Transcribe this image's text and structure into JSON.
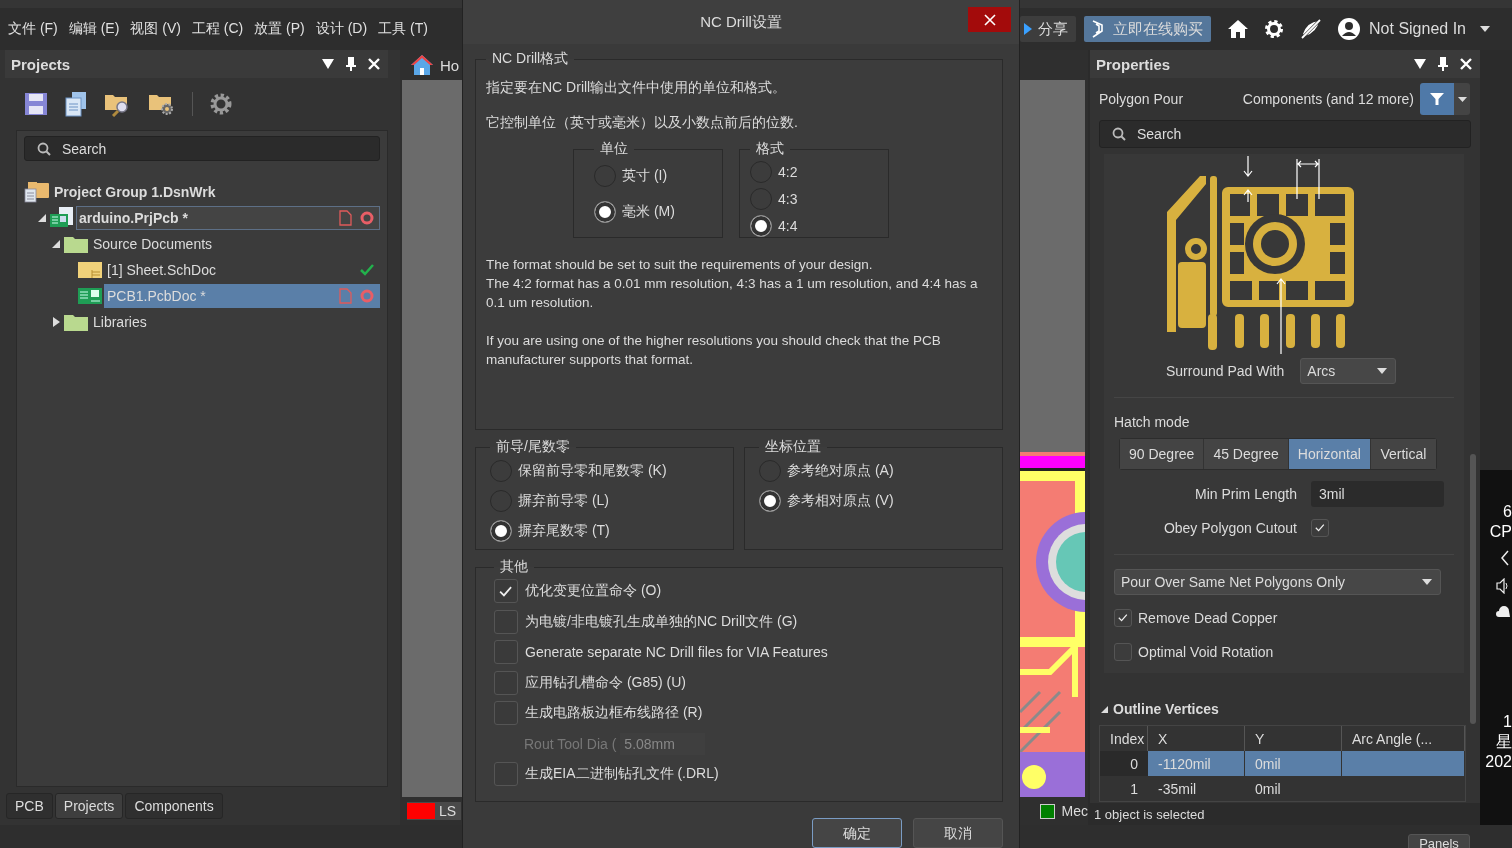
{
  "menubar": {
    "items": [
      "文件 (F)",
      "编辑 (E)",
      "视图 (V)",
      "工程 (C)",
      "放置 (P)",
      "设计 (D)",
      "工具 (T)"
    ],
    "share_button": "分享",
    "buy_button": "立即在线购买",
    "user": "Not Signed In"
  },
  "projects_panel": {
    "title": "Projects",
    "search": {
      "placeholder": "Search"
    },
    "tree": [
      {
        "label": "Project Group 1.DsnWrk",
        "kind": "group",
        "selected": false,
        "focused": false,
        "children": [
          {
            "label": "arduino.PrjPcb *",
            "kind": "project",
            "expanded": true,
            "selected": false,
            "focused": true,
            "modified": true,
            "children": [
              {
                "label": "Source Documents",
                "kind": "folder",
                "expanded": true,
                "selected": false,
                "focused": false,
                "children": [
                  {
                    "label": "[1] Sheet.SchDoc",
                    "kind": "sch",
                    "selected": false,
                    "focused": false,
                    "modified": false
                  },
                  {
                    "label": "PCB1.PcbDoc *",
                    "kind": "pcb",
                    "selected": true,
                    "focused": false,
                    "modified": true
                  }
                ]
              },
              {
                "label": "Libraries",
                "kind": "folder",
                "expanded": false,
                "selected": false,
                "focused": false
              }
            ]
          }
        ]
      }
    ],
    "tabs": [
      {
        "label": "PCB",
        "selected": false
      },
      {
        "label": "Projects",
        "selected": true
      },
      {
        "label": "Components",
        "selected": false
      }
    ]
  },
  "editor": {
    "tab": "Ho",
    "layers": [
      {
        "label": "LS",
        "color": "#ff0000"
      },
      {
        "label": "Mec",
        "color": "#008000"
      }
    ]
  },
  "dialog": {
    "title": "NC Drill设置",
    "format_group": {
      "legend": "NC Drill格式",
      "intro": [
        "指定要在NC Drill输出文件中使用的单位和格式。",
        "它控制单位（英寸或毫米）以及小数点前后的位数."
      ],
      "units": {
        "legend": "单位",
        "options": [
          {
            "label": "英寸 (I)",
            "selected": false
          },
          {
            "label": "毫米 (M)",
            "selected": true
          }
        ]
      },
      "format": {
        "legend": "格式",
        "options": [
          {
            "label": "4:2",
            "selected": false
          },
          {
            "label": "4:3",
            "selected": false
          },
          {
            "label": "4:4",
            "selected": true
          }
        ]
      },
      "notes": [
        "The format should be set to suit the requirements of your design.\nThe 4:2 format has a 0.01 mm resolution, 4:3 has a 1 um resolution, and 4:4 has a 0.1 um resolution.",
        "If you are using one of the higher resolutions you should check that the PCB manufacturer supports that format."
      ]
    },
    "zeros": {
      "legend": "前导/尾数零",
      "options": [
        {
          "label": "保留前导零和尾数零 (K)",
          "selected": false
        },
        {
          "label": "摒弃前导零 (L)",
          "selected": false
        },
        {
          "label": "摒弃尾数零 (T)",
          "selected": true
        }
      ]
    },
    "coordinates": {
      "legend": "坐标位置",
      "options": [
        {
          "label": "参考绝对原点 (A)",
          "selected": false
        },
        {
          "label": "参考相对原点 (V)",
          "selected": true
        }
      ]
    },
    "other": {
      "legend": "其他",
      "items": [
        {
          "kind": "checkbox",
          "label": "优化变更位置命令 (O)",
          "checked": true
        },
        {
          "kind": "checkbox",
          "label": "为电镀/非电镀孔生成单独的NC Drill文件 (G)",
          "checked": false
        },
        {
          "kind": "checkbox",
          "label": "Generate separate NC Drill files for VIA Features",
          "checked": false
        },
        {
          "kind": "checkbox",
          "label": "应用钻孔槽命令 (G85) (U)",
          "checked": false
        },
        {
          "kind": "checkbox",
          "label": "生成电路板边框布线路径 (R)",
          "checked": false
        },
        {
          "kind": "field",
          "label": "Rout Tool  Dia (",
          "value": "5.08mm",
          "disabled": true
        },
        {
          "kind": "checkbox",
          "label": "生成EIA二进制钻孔文件 (.DRL)",
          "checked": false
        }
      ]
    },
    "buttons": [
      "确定",
      "取消"
    ]
  },
  "properties": {
    "title": "Properties",
    "object": "Polygon Pour",
    "filter": "Components (and 12 more)",
    "search": {
      "placeholder": "Search"
    },
    "surround_label": "Surround Pad With",
    "surround_value": "Arcs",
    "hatch_label": "Hatch mode",
    "hatch_modes": [
      {
        "label": "90 Degree",
        "selected": false
      },
      {
        "label": "45 Degree",
        "selected": false
      },
      {
        "label": "Horizontal",
        "selected": true
      },
      {
        "label": "Vertical",
        "selected": false
      }
    ],
    "min_prim_label": "Min Prim Length",
    "min_prim_value": "3mil",
    "obey_label": "Obey Polygon Cutout",
    "obey_checked": true,
    "pour_over": "Pour Over Same Net Polygons Only",
    "options": [
      {
        "label": "Remove Dead Copper",
        "checked": true
      },
      {
        "label": "Optimal Void Rotation",
        "checked": false
      }
    ],
    "vertices": {
      "title": "Outline Vertices",
      "expanded": true,
      "columns": [
        "Index",
        "X",
        "Y",
        "Arc Angle (..."
      ],
      "rows": [
        {
          "index": "0",
          "x": "-1120mil",
          "y": "0mil",
          "selected": true
        },
        {
          "index": "1",
          "x": "-35mil",
          "y": "0mil",
          "selected": false
        }
      ]
    },
    "status": "1 object is selected"
  },
  "taskbar": [
    "6",
    "CP",
    "1",
    "星",
    "202"
  ],
  "panels_button": "Panels"
}
